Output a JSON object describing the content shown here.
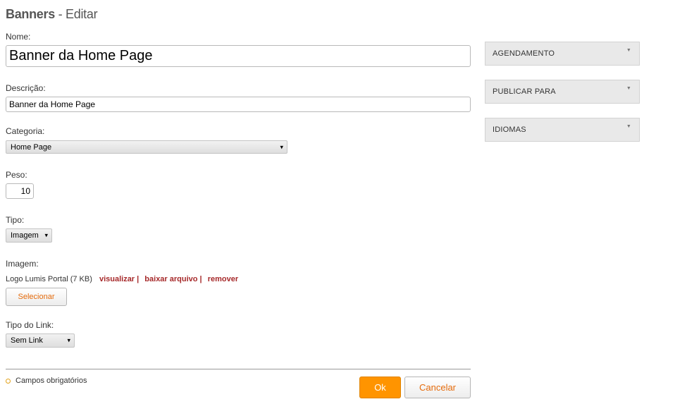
{
  "page": {
    "title_bold": "Banners",
    "title_rest": "- Editar"
  },
  "form": {
    "nome": {
      "label": "Nome:",
      "value": "Banner da Home Page"
    },
    "descricao": {
      "label": "Descrição:",
      "value": "Banner da Home Page"
    },
    "categoria": {
      "label": "Categoria:",
      "value": "Home Page"
    },
    "peso": {
      "label": "Peso:",
      "value": "10"
    },
    "tipo": {
      "label": "Tipo:",
      "value": "Imagem"
    },
    "imagem": {
      "label": "Imagem:",
      "file": "Logo Lumis Portal (7 KB)",
      "visualizar": "visualizar |",
      "baixar": "baixar arquivo |",
      "remover": "remover",
      "select_button": "Selecionar"
    },
    "tipo_link": {
      "label": "Tipo do Link:",
      "value": "Sem Link"
    }
  },
  "footer": {
    "required_note": "Campos obrigatórios",
    "ok": "Ok",
    "cancel": "Cancelar"
  },
  "side_panels": [
    {
      "label": "AGENDAMENTO"
    },
    {
      "label": "PUBLICAR PARA"
    },
    {
      "label": "IDIOMAS"
    }
  ],
  "icons": {
    "dropdown": "▾",
    "panel_toggle": "▼"
  },
  "colors": {
    "ok_button": "#ff9400",
    "link": "#a6292a",
    "select_button_text": "#e56b0c",
    "required_marker": "#e3a21a"
  }
}
